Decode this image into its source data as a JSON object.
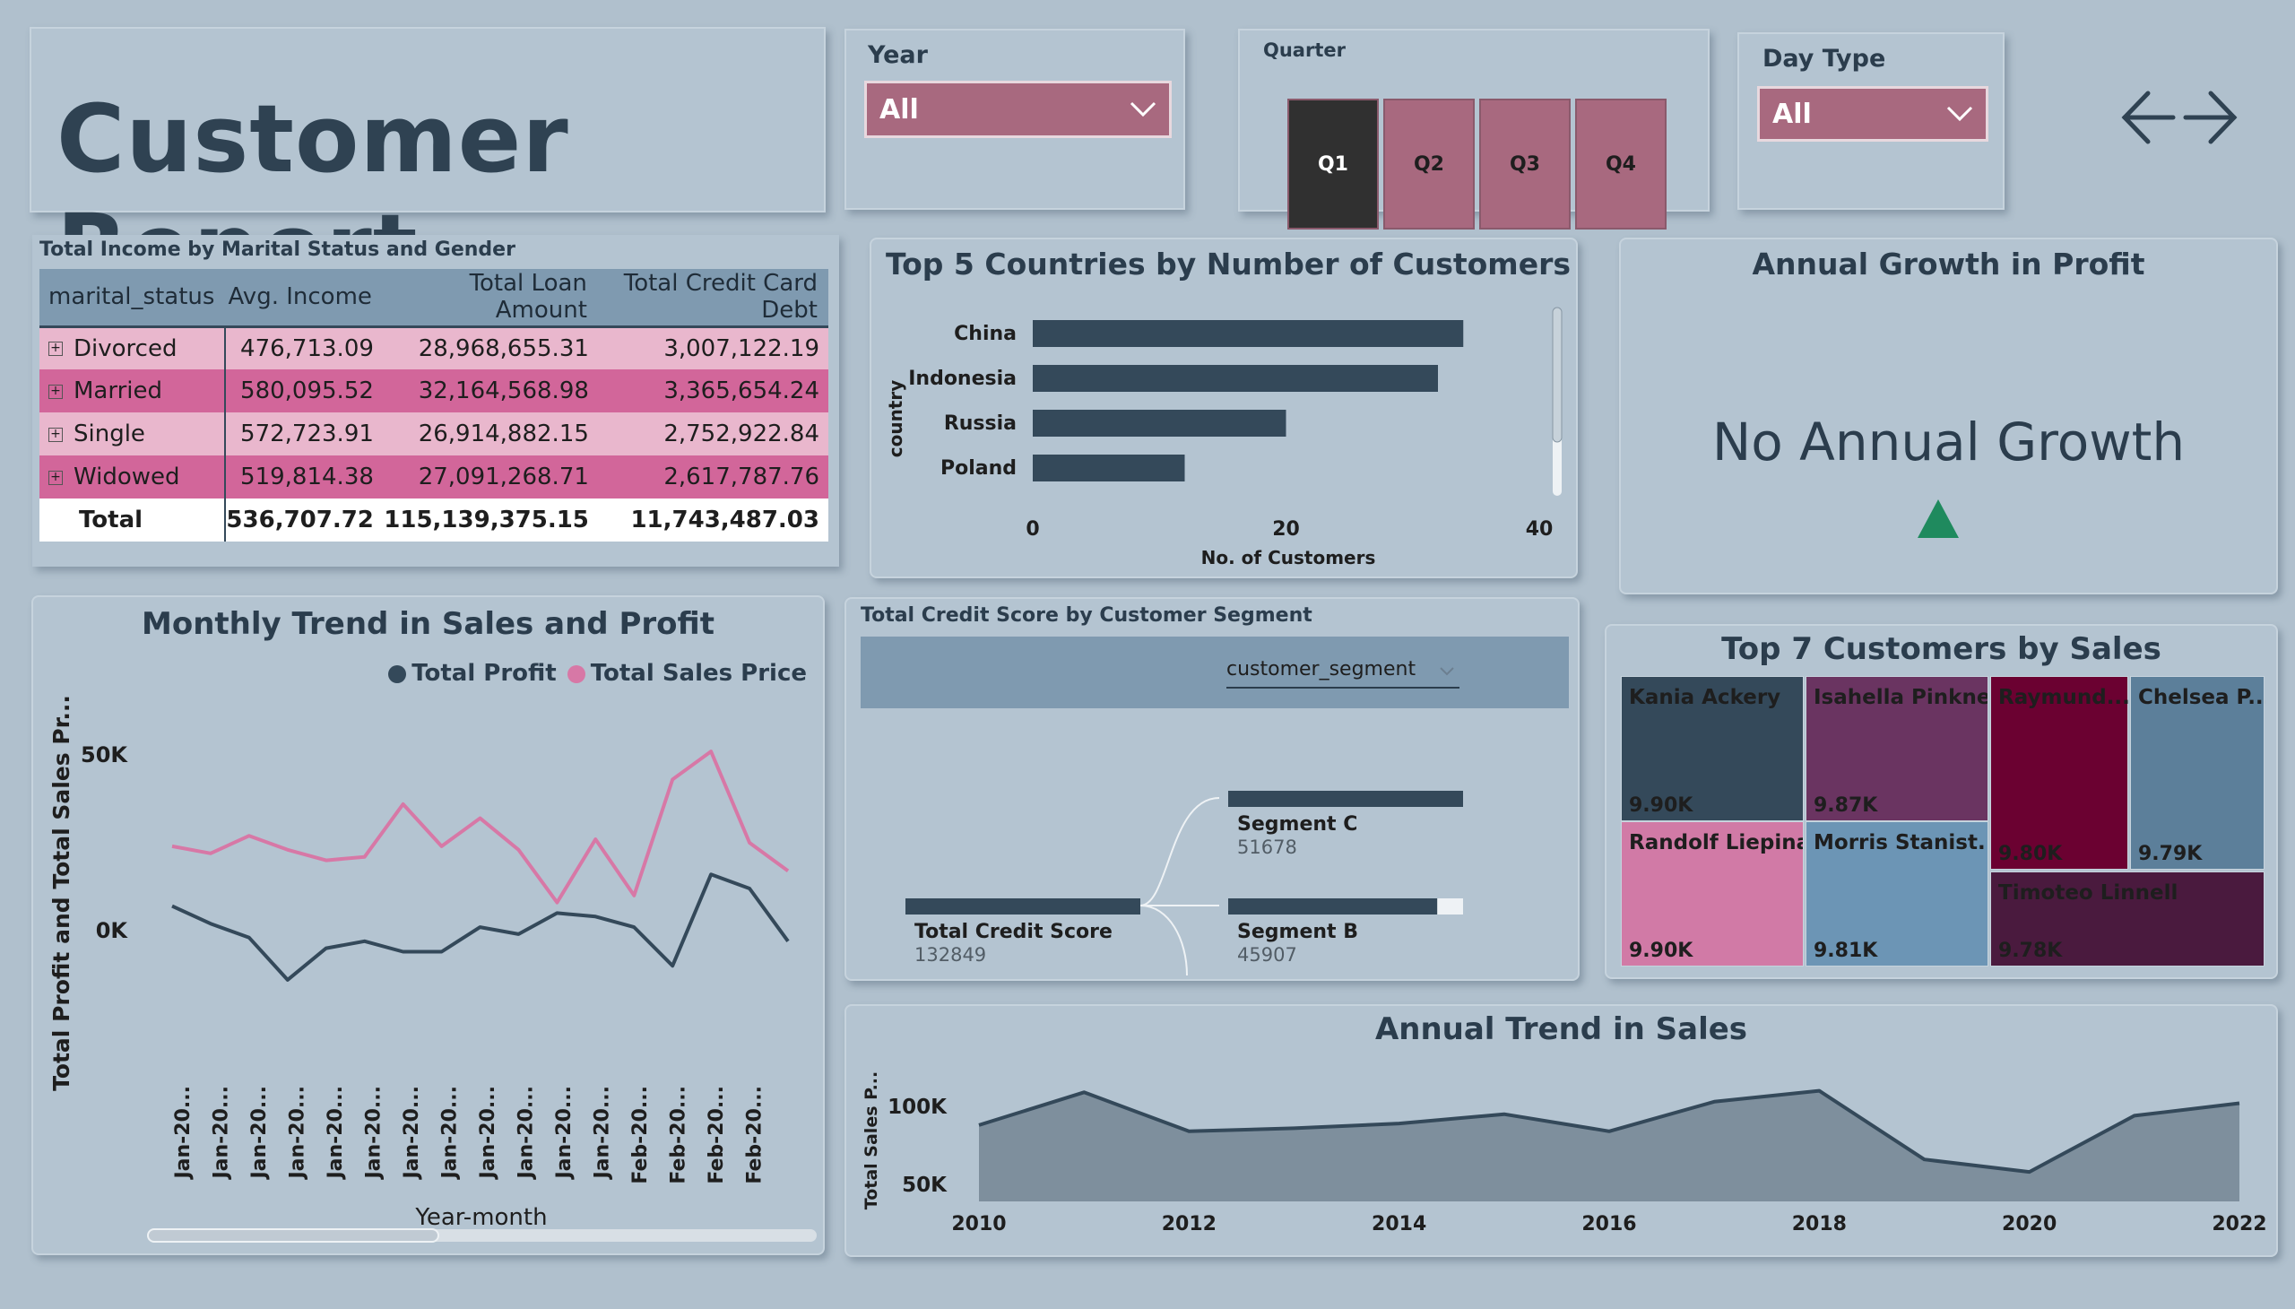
{
  "title": "Customer Report",
  "slicers": {
    "year": {
      "label": "Year",
      "value": "All"
    },
    "quarter": {
      "label": "Quarter",
      "options": [
        "Q1",
        "Q2",
        "Q3",
        "Q4"
      ],
      "selected": "Q1"
    },
    "daytype": {
      "label": "Day Type",
      "value": "All"
    }
  },
  "nav": {
    "icon": "back-forward-arrows-icon"
  },
  "matrix": {
    "title": "Total Income by Marital Status and Gender",
    "headers": [
      "marital_status",
      "Avg. Income",
      "Total Loan Amount",
      "Total Credit Card Debt"
    ],
    "rows": [
      [
        "Divorced",
        "476,713.09",
        "28,968,655.31",
        "3,007,122.19"
      ],
      [
        "Married",
        "580,095.52",
        "32,164,568.98",
        "3,365,654.24"
      ],
      [
        "Single",
        "572,723.91",
        "26,914,882.15",
        "2,752,922.84"
      ],
      [
        "Widowed",
        "519,814.38",
        "27,091,268.71",
        "2,617,787.76"
      ]
    ],
    "total": [
      "Total",
      "536,707.72",
      "115,139,375.15",
      "11,743,487.03"
    ]
  },
  "countries": {
    "title": "Top 5 Countries by Number of Customers",
    "ylabel": "country",
    "xlabel": "No. of Customers",
    "xticks": [
      "0",
      "20",
      "40"
    ],
    "chart_data": {
      "type": "bar",
      "categories": [
        "China",
        "Indonesia",
        "Russia",
        "Poland"
      ],
      "values": [
        34,
        32,
        20,
        12
      ],
      "xlim": [
        0,
        40
      ]
    }
  },
  "growth": {
    "title": "Annual Growth in Profit",
    "value": "No Annual Growth",
    "icon_color": "#1f8a5e"
  },
  "monthly": {
    "title": "Monthly Trend in Sales and Profit",
    "legend": [
      {
        "name": "Total Profit",
        "color": "#34495a"
      },
      {
        "name": "Total Sales Price",
        "color": "#d778a6"
      }
    ],
    "ylabel": "Total Profit and Total Sales Pr...",
    "xlabel": "Year-month",
    "yticks": [
      "50K",
      "0K"
    ],
    "xticks": [
      "Jan-20...",
      "Jan-20...",
      "Jan-20...",
      "Jan-20...",
      "Jan-20...",
      "Jan-20...",
      "Jan-20...",
      "Jan-20...",
      "Jan-20...",
      "Jan-20...",
      "Jan-20...",
      "Jan-20...",
      "Feb-20...",
      "Feb-20...",
      "Feb-20...",
      "Feb-20..."
    ],
    "chart_data": {
      "type": "line",
      "series": [
        {
          "name": "Total Sales Price",
          "values": [
            24,
            22,
            27,
            23,
            20,
            21,
            36,
            24,
            32,
            23,
            8,
            26,
            10,
            43,
            51,
            25,
            17
          ]
        },
        {
          "name": "Total Profit",
          "values": [
            7,
            2,
            -2,
            -14,
            -5,
            -3,
            -6,
            -6,
            1,
            -1,
            5,
            4,
            1,
            -10,
            16,
            12,
            -3
          ]
        }
      ],
      "ylim": [
        -25,
        60
      ]
    }
  },
  "credit": {
    "title": "Total Credit Score by Customer Segment",
    "field": "customer_segment",
    "root_label": "Total Credit Score",
    "root_value": "132849",
    "children": [
      {
        "label": "Segment C",
        "value": "51678",
        "fill": 1.0
      },
      {
        "label": "Segment B",
        "value": "45907",
        "fill": 0.89
      }
    ]
  },
  "treemap": {
    "title": "Top 7 Customers by Sales",
    "items": [
      {
        "name": "Kania Ackery",
        "value": "9.90K",
        "color": "#34495a"
      },
      {
        "name": "Randolf Liepina",
        "value": "9.90K",
        "color": "#d17aa6"
      },
      {
        "name": "Isahella Pinkney",
        "value": "9.87K",
        "color": "#6a3461"
      },
      {
        "name": "Morris Stanist...",
        "value": "9.81K",
        "color": "#6c95b5"
      },
      {
        "name": "Raymund...",
        "value": "9.80K",
        "color": "#6b0131"
      },
      {
        "name": "Chelsea P...",
        "value": "9.79K",
        "color": "#5c7f9a"
      },
      {
        "name": "Timoteo Linnell",
        "value": "9.78K",
        "color": "#4a1a3e"
      }
    ]
  },
  "annual": {
    "title": "Annual Trend in Sales",
    "ylabel": "Total Sales P...",
    "yticks": [
      "100K",
      "50K"
    ],
    "xticks": [
      "2010",
      "2012",
      "2014",
      "2016",
      "2018",
      "2020",
      "2022"
    ],
    "chart_data": {
      "type": "area",
      "x": [
        2010,
        2011,
        2012,
        2013,
        2014,
        2015,
        2016,
        2017,
        2018,
        2019,
        2020,
        2021,
        2022
      ],
      "values": [
        88,
        109,
        84,
        86,
        89,
        95,
        84,
        103,
        110,
        66,
        58,
        94,
        102
      ],
      "ylim": [
        40,
        120
      ]
    }
  }
}
